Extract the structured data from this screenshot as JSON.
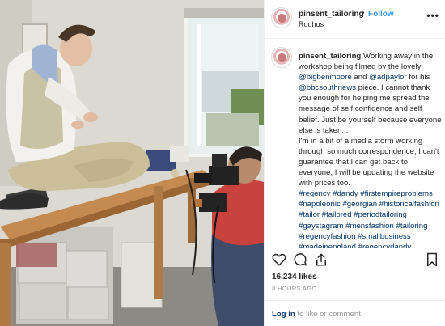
{
  "post": {
    "username": "pinsent_tailoring",
    "separator": "•",
    "follow_label": "Follow",
    "location": "Rodhus",
    "more_label": "•••",
    "caption": {
      "username": "pinsent_tailoring",
      "text_1": " Working away in the workshop being filmed by the lovely ",
      "mention_1": "@bigbenmoore",
      "text_2": " and ",
      "mention_2": "@adpaylor",
      "text_3": " for his ",
      "mention_3": "@bbcsouthnews",
      "text_4": " piece. I cannot thank you enough for helping me spread the message of self confidence and self belief. Just be yourself because everyone else is taken. .",
      "text_5": "I'm in a bit of a media storm working through so much correspondence, I can't guarantee that I can get back to everyone, I will be updating the website with prices too.",
      "hashtags": "#regency #dandy #firstempireproblems #napoleonic #georgian #historicalfashion #tailor #tailored #periodtailoring #gaystagram #mensfashion #tailoring #regencyfashion #smallbusiness #madeinengland #regencydandy"
    },
    "likes": "16,234 likes",
    "time": "8 HOURS AGO",
    "login_link": "Log in",
    "login_rest": " to like or comment."
  },
  "icons": {
    "like": "heart-icon",
    "comment": "comment-bubble-icon",
    "share": "share-icon",
    "save": "bookmark-icon"
  },
  "colors": {
    "follow": "#3897f0",
    "link": "#003569",
    "muted": "#999999",
    "text": "#262626",
    "border": "#efefef"
  }
}
